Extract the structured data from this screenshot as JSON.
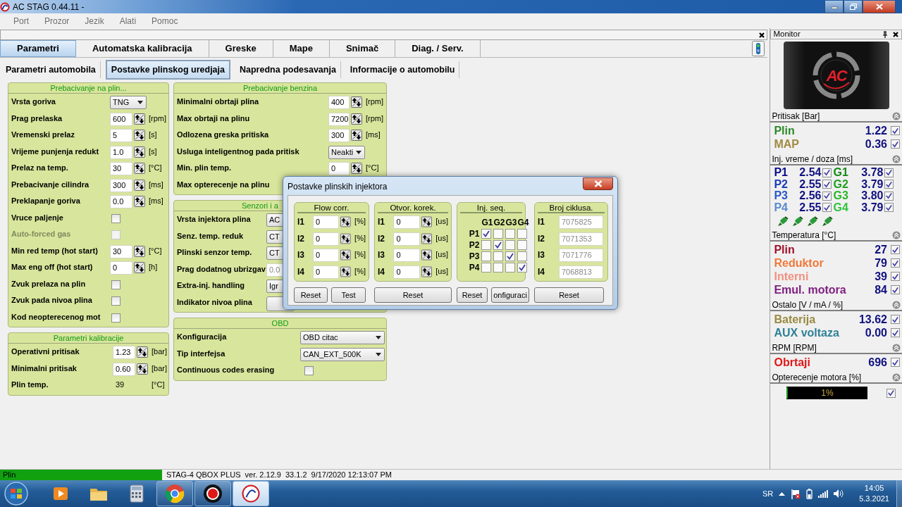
{
  "window": {
    "title": "AC STAG 0.44.11 -"
  },
  "menu": [
    {
      "label": "Port",
      "disabled": true
    },
    {
      "label": "Prozor",
      "disabled": true
    },
    {
      "label": "Jezik",
      "disabled": true
    },
    {
      "label": "Alati",
      "disabled": true
    },
    {
      "label": "Pomoc",
      "disabled": true
    }
  ],
  "tabs": [
    {
      "label": "Parametri",
      "selected": true
    },
    {
      "label": "Automatska kalibracija",
      "selected": false
    },
    {
      "label": "Greske",
      "selected": false
    },
    {
      "label": "Mape",
      "selected": false
    },
    {
      "label": "Snimač",
      "selected": false
    },
    {
      "label": "Diag. / Serv.",
      "selected": false
    }
  ],
  "subtabs": [
    {
      "label": "Parametri automobila",
      "selected": false
    },
    {
      "label": "Postavke plinskog uredjaja",
      "selected": true
    },
    {
      "label": "Napredna podesavanja",
      "selected": false
    },
    {
      "label": "Informacije o automobilu",
      "selected": false
    }
  ],
  "columns": [
    {
      "panels": [
        {
          "title": "Prebacivanje na plin...",
          "rows": [
            {
              "kind": "select",
              "label": "Vrsta goriva",
              "value": "TNG"
            },
            {
              "kind": "spin",
              "label": "Prag prelaska",
              "value": "600",
              "unit": "[rpm]"
            },
            {
              "kind": "spin",
              "label": "Vremenski prelaz",
              "value": "5",
              "unit": "[s]"
            },
            {
              "kind": "spin",
              "label": "Vrijeme punjenja redukt",
              "value": "1.0",
              "unit": "[s]"
            },
            {
              "kind": "spin",
              "label": "Prelaz na temp.",
              "value": "30",
              "unit": "[°C]"
            },
            {
              "kind": "spin",
              "label": "Prebacivanje cilindra",
              "value": "300",
              "unit": "[ms]"
            },
            {
              "kind": "spin",
              "label": "Preklapanje goriva",
              "value": "0.0",
              "unit": "[ms]"
            },
            {
              "kind": "check",
              "label": "Vruce paljenje",
              "checked": false,
              "disabled": false
            },
            {
              "kind": "check",
              "label": "Auto-forced gas",
              "checked": false,
              "disabled": true
            },
            {
              "kind": "spin",
              "label": "Min red temp (hot start)",
              "value": "30",
              "unit": "[°C]"
            },
            {
              "kind": "spin",
              "label": "Max eng off (hot start)",
              "value": "0",
              "unit": "[h]"
            },
            {
              "kind": "check",
              "label": "Zvuk prelaza na plin",
              "checked": false,
              "disabled": false
            },
            {
              "kind": "check",
              "label": "Zvuk pada nivoa plina",
              "checked": false,
              "disabled": false
            },
            {
              "kind": "check",
              "label": "Kod neopterecenog mot",
              "checked": false,
              "disabled": false
            }
          ]
        },
        {
          "title": "Parametri kalibracije",
          "rows": [
            {
              "kind": "spin",
              "label": "Operativni pritisak",
              "value": "1.23",
              "unit": "[bar]"
            },
            {
              "kind": "spin",
              "label": "Minimalni pritisak",
              "value": "0.60",
              "unit": "[bar]"
            },
            {
              "kind": "readout",
              "label": "Plin temp.",
              "value": "39",
              "unit": "[°C]"
            }
          ]
        }
      ]
    },
    {
      "panels": [
        {
          "title": "Prebacivanje benzina",
          "rows": [
            {
              "kind": "spin",
              "label": "Minimalni obrtaji plina",
              "value": "400",
              "unit": "[rpm]"
            },
            {
              "kind": "spin",
              "label": "Max obrtaji na plinu",
              "value": "7200",
              "unit": "[rpm]"
            },
            {
              "kind": "spin",
              "label": "Odlozena greska pritiska",
              "value": "300",
              "unit": "[ms]"
            },
            {
              "kind": "select",
              "label": "Usluga inteligentnog pada pritisk",
              "value": "Neakti"
            },
            {
              "kind": "spin",
              "label": "Min. plin temp.",
              "value": "0",
              "unit": "[°C]"
            },
            {
              "kind": "label",
              "label": "Max opterecenje na plinu"
            }
          ]
        },
        {
          "title": "Senzori i a",
          "rows": [
            {
              "kind": "select",
              "label": "Vrsta injektora plina",
              "value": "AC"
            },
            {
              "kind": "select",
              "label": "Senz. temp. reduk",
              "value": "CT"
            },
            {
              "kind": "select",
              "label": "Plinski senzor temp.",
              "value": "CT"
            },
            {
              "kind": "field",
              "label": "Prag dodatnog ubrizgav",
              "value": "0.0"
            },
            {
              "kind": "select",
              "label": "Extra-inj. handling",
              "value": "Igr"
            },
            {
              "kind": "button",
              "label": "Indikator nivoa plina"
            }
          ]
        },
        {
          "title": "OBD",
          "rows": [
            {
              "kind": "select",
              "label": "Konfiguracija",
              "value": "OBD citac"
            },
            {
              "kind": "select",
              "label": "Tip interfejsa",
              "value": "CAN_EXT_500K"
            },
            {
              "kind": "check",
              "label": "Continuous codes erasing",
              "checked": false,
              "disabled": false
            }
          ]
        }
      ]
    }
  ],
  "dialog": {
    "title": "Postavke plinskih injektora",
    "groups": [
      {
        "kind": "spin",
        "title": "Flow corr.",
        "rows": [
          {
            "label": "I1",
            "value": "0",
            "unit": "[%]"
          },
          {
            "label": "I2",
            "value": "0",
            "unit": "[%]"
          },
          {
            "label": "I3",
            "value": "0",
            "unit": "[%]"
          },
          {
            "label": "I4",
            "value": "0",
            "unit": "[%]"
          }
        ],
        "buttons": [
          "Reset",
          "Test"
        ]
      },
      {
        "kind": "spin",
        "title": "Otvor. korek.",
        "rows": [
          {
            "label": "I1",
            "value": "0",
            "unit": "[us]"
          },
          {
            "label": "I2",
            "value": "0",
            "unit": "[us]"
          },
          {
            "label": "I3",
            "value": "0",
            "unit": "[us]"
          },
          {
            "label": "I4",
            "value": "0",
            "unit": "[us]"
          }
        ],
        "buttons": [
          "Reset"
        ]
      },
      {
        "kind": "matrix",
        "title": "Inj. seq.",
        "columns": [
          "G1",
          "G2",
          "G3",
          "G4"
        ],
        "rows": [
          {
            "label": "P1",
            "cells": [
              true,
              false,
              false,
              false
            ]
          },
          {
            "label": "P2",
            "cells": [
              false,
              true,
              false,
              false
            ]
          },
          {
            "label": "P3",
            "cells": [
              false,
              false,
              true,
              false
            ]
          },
          {
            "label": "P4",
            "cells": [
              false,
              false,
              false,
              true
            ]
          }
        ],
        "buttons": [
          "Reset",
          "onfiguraci"
        ]
      },
      {
        "kind": "readonly",
        "title": "Broj ciklusa.",
        "rows": [
          {
            "label": "I1",
            "value": "7075825"
          },
          {
            "label": "I2",
            "value": "7071353"
          },
          {
            "label": "I3",
            "value": "7071776"
          },
          {
            "label": "I4",
            "value": "7068813"
          }
        ],
        "buttons": [
          "Reset"
        ]
      }
    ]
  },
  "monitor": {
    "title": "Monitor",
    "logo_text": "AC",
    "sections": [
      {
        "title": "Pritisak [Bar]",
        "kind": "list",
        "items": [
          {
            "label": "Plin",
            "value": "1.22",
            "color": "#2a8a2a",
            "checked": true
          },
          {
            "label": "MAP",
            "value": "0.36",
            "color": "#a08a40",
            "checked": true
          }
        ]
      },
      {
        "title": "Inj. vreme / doza [ms]",
        "kind": "grid",
        "items": [
          {
            "label": "P1",
            "value": "2.54",
            "color": "#0a0a90",
            "checked": true
          },
          {
            "label": "G1",
            "value": "3.78",
            "color": "#158a15",
            "checked": true
          },
          {
            "label": "P2",
            "value": "2.55",
            "color": "#1a3ab8",
            "checked": true
          },
          {
            "label": "G2",
            "value": "3.79",
            "color": "#1fa01f",
            "checked": true
          },
          {
            "label": "P3",
            "value": "2.56",
            "color": "#2858c8",
            "checked": true
          },
          {
            "label": "G3",
            "value": "3.80",
            "color": "#28b828",
            "checked": true
          },
          {
            "label": "P4",
            "value": "2.55",
            "color": "#5a8ad0",
            "checked": true
          },
          {
            "label": "G4",
            "value": "3.79",
            "color": "#30c440",
            "checked": true
          }
        ]
      },
      {
        "title": "Temperatura [°C]",
        "kind": "list",
        "items": [
          {
            "label": "Plin",
            "value": "27",
            "color": "#a0102a",
            "checked": true
          },
          {
            "label": "Reduktor",
            "value": "79",
            "color": "#f07838",
            "checked": true
          },
          {
            "label": "Interni",
            "value": "39",
            "color": "#f09080",
            "checked": true
          },
          {
            "label": "Emul. motora",
            "value": "84",
            "color": "#802080",
            "checked": true
          }
        ]
      },
      {
        "title": "Ostalo [V / mA / %]",
        "kind": "list",
        "items": [
          {
            "label": "Baterija",
            "value": "13.62",
            "color": "#9a8a40",
            "checked": true
          },
          {
            "label": "AUX voltaza",
            "value": "0.00",
            "color": "#2e8098",
            "checked": true
          }
        ]
      },
      {
        "title": "RPM [RPM]",
        "kind": "list",
        "items": [
          {
            "label": "Obrtaji",
            "value": "696",
            "color": "#e01818",
            "checked": true
          }
        ]
      },
      {
        "title": "Opterecenje motora [%]",
        "kind": "bar",
        "level": 0.01,
        "reading": "1%",
        "checked": true
      }
    ]
  },
  "status_bar": {
    "mode": "Plin",
    "items": [
      "STAG-4 QBOX PLUS",
      "ver. 2.12.9",
      "33.1.2",
      "9/17/2020 12:13:07 PM"
    ]
  },
  "taskbar": {
    "apps": [
      {
        "kind": "media",
        "running": false,
        "active": false
      },
      {
        "kind": "folder",
        "running": false,
        "active": false
      },
      {
        "kind": "calculator",
        "running": false,
        "active": false
      },
      {
        "kind": "chrome",
        "running": true,
        "active": false
      },
      {
        "kind": "record",
        "running": true,
        "active": false
      },
      {
        "kind": "ac",
        "running": true,
        "active": true
      }
    ],
    "language": "SR",
    "time": "14:05",
    "date": "5.3.2021"
  }
}
